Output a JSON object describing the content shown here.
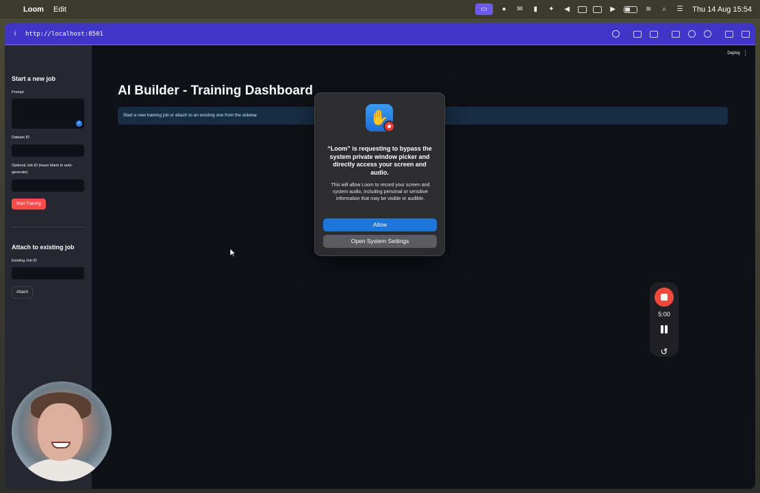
{
  "menubar": {
    "apple_glyph": "",
    "app_name": "Loom",
    "menus": [
      "Edit"
    ],
    "clock": "Thu 14 Aug  15:54"
  },
  "browser": {
    "url": "http://localhost:8501",
    "info_glyph": "i"
  },
  "sidebar": {
    "new_job_heading": "Start a new job",
    "prompt_label": "Prompt",
    "dataset_label": "Dataset ID",
    "job_id_label": "Optional Job ID (leave blank to auto-generate)",
    "start_button": "Start Training",
    "attach_heading": "Attach to existing job",
    "existing_job_label": "Existing Job ID",
    "attach_button": "Attach"
  },
  "main": {
    "deploy": "Deploy",
    "kebab": "⋮",
    "title": "AI Builder - Training Dashboard",
    "info_message": "Start a new training job or attach to an existing one from the sidebar."
  },
  "dialog": {
    "title": "“Loom” is requesting to bypass the system private window picker and directly access your screen and audio.",
    "body": "This will allow Loom to record your screen and system audio, including personal or sensitive information that may be visible or audible.",
    "allow_button": "Allow",
    "settings_button": "Open System Settings"
  },
  "recorder": {
    "timer": "5:00"
  },
  "colors": {
    "accent": "#ff4b4b",
    "address_bar": "#3f35c8",
    "info_banner": "#172d43",
    "allow": "#1d74d9"
  }
}
